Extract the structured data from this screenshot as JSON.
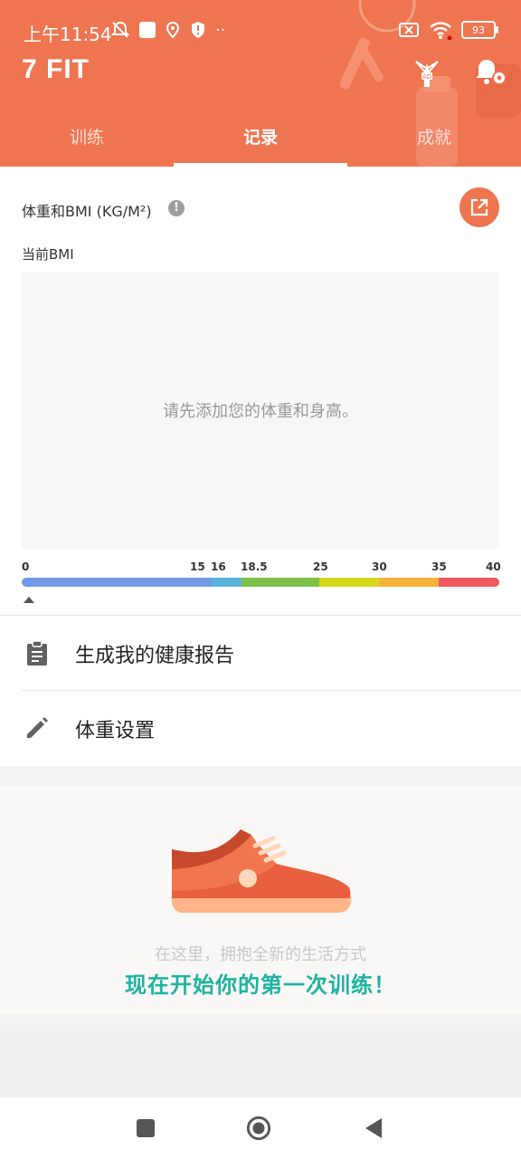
{
  "status_bar": {
    "time": "上午11:54",
    "battery": "93"
  },
  "app": {
    "title": "7 FIT"
  },
  "tabs": [
    {
      "label": "训练",
      "active": false
    },
    {
      "label": "记录",
      "active": true
    },
    {
      "label": "成就",
      "active": false
    }
  ],
  "weight_card": {
    "title": "体重和BMI (KG/M²)",
    "info_glyph": "!",
    "current_bmi_label": "当前BMI",
    "empty_message": "请先添加您的体重和身高。",
    "scale_ticks": [
      "0",
      "15",
      "16",
      "18.5",
      "25",
      "30",
      "35",
      "40"
    ],
    "scale_colors": [
      "#6f9be6",
      "#5ab3d9",
      "#7cc24a",
      "#d6d91c",
      "#f5b23a",
      "#f0585c"
    ],
    "pointer_value": 0
  },
  "menu": [
    {
      "label": "生成我的健康报告",
      "icon": "clipboard-icon"
    },
    {
      "label": "体重设置",
      "icon": "pencil-icon"
    }
  ],
  "promo": {
    "subtitle": "在这里，拥抱全新的生活方式",
    "cta": "现在开始你的第一次训练！"
  },
  "colors": {
    "accent": "#ee7550",
    "cta": "#1eb3a0"
  }
}
